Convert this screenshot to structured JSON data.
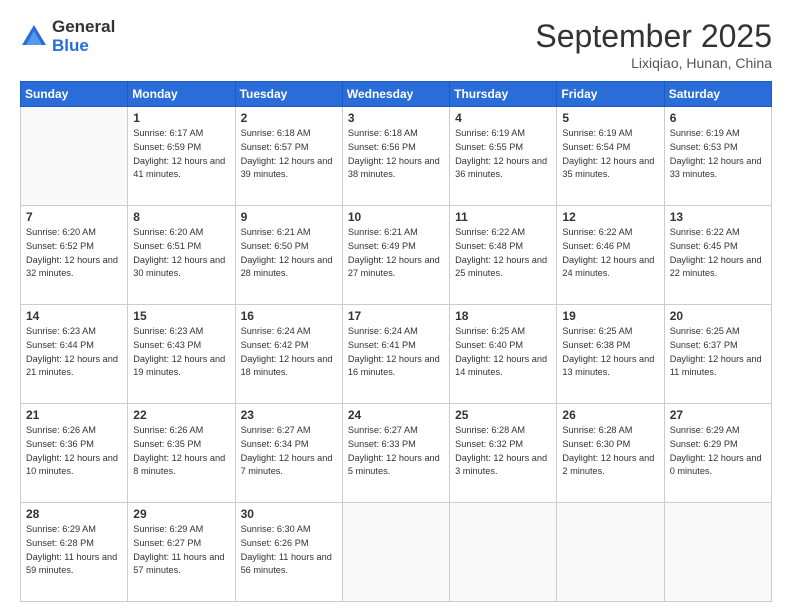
{
  "header": {
    "logo_general": "General",
    "logo_blue": "Blue",
    "month_title": "September 2025",
    "location": "Lixiqiao, Hunan, China"
  },
  "weekdays": [
    "Sunday",
    "Monday",
    "Tuesday",
    "Wednesday",
    "Thursday",
    "Friday",
    "Saturday"
  ],
  "weeks": [
    [
      {
        "day": "",
        "sunrise": "",
        "sunset": "",
        "daylight": ""
      },
      {
        "day": "1",
        "sunrise": "Sunrise: 6:17 AM",
        "sunset": "Sunset: 6:59 PM",
        "daylight": "Daylight: 12 hours and 41 minutes."
      },
      {
        "day": "2",
        "sunrise": "Sunrise: 6:18 AM",
        "sunset": "Sunset: 6:57 PM",
        "daylight": "Daylight: 12 hours and 39 minutes."
      },
      {
        "day": "3",
        "sunrise": "Sunrise: 6:18 AM",
        "sunset": "Sunset: 6:56 PM",
        "daylight": "Daylight: 12 hours and 38 minutes."
      },
      {
        "day": "4",
        "sunrise": "Sunrise: 6:19 AM",
        "sunset": "Sunset: 6:55 PM",
        "daylight": "Daylight: 12 hours and 36 minutes."
      },
      {
        "day": "5",
        "sunrise": "Sunrise: 6:19 AM",
        "sunset": "Sunset: 6:54 PM",
        "daylight": "Daylight: 12 hours and 35 minutes."
      },
      {
        "day": "6",
        "sunrise": "Sunrise: 6:19 AM",
        "sunset": "Sunset: 6:53 PM",
        "daylight": "Daylight: 12 hours and 33 minutes."
      }
    ],
    [
      {
        "day": "7",
        "sunrise": "Sunrise: 6:20 AM",
        "sunset": "Sunset: 6:52 PM",
        "daylight": "Daylight: 12 hours and 32 minutes."
      },
      {
        "day": "8",
        "sunrise": "Sunrise: 6:20 AM",
        "sunset": "Sunset: 6:51 PM",
        "daylight": "Daylight: 12 hours and 30 minutes."
      },
      {
        "day": "9",
        "sunrise": "Sunrise: 6:21 AM",
        "sunset": "Sunset: 6:50 PM",
        "daylight": "Daylight: 12 hours and 28 minutes."
      },
      {
        "day": "10",
        "sunrise": "Sunrise: 6:21 AM",
        "sunset": "Sunset: 6:49 PM",
        "daylight": "Daylight: 12 hours and 27 minutes."
      },
      {
        "day": "11",
        "sunrise": "Sunrise: 6:22 AM",
        "sunset": "Sunset: 6:48 PM",
        "daylight": "Daylight: 12 hours and 25 minutes."
      },
      {
        "day": "12",
        "sunrise": "Sunrise: 6:22 AM",
        "sunset": "Sunset: 6:46 PM",
        "daylight": "Daylight: 12 hours and 24 minutes."
      },
      {
        "day": "13",
        "sunrise": "Sunrise: 6:22 AM",
        "sunset": "Sunset: 6:45 PM",
        "daylight": "Daylight: 12 hours and 22 minutes."
      }
    ],
    [
      {
        "day": "14",
        "sunrise": "Sunrise: 6:23 AM",
        "sunset": "Sunset: 6:44 PM",
        "daylight": "Daylight: 12 hours and 21 minutes."
      },
      {
        "day": "15",
        "sunrise": "Sunrise: 6:23 AM",
        "sunset": "Sunset: 6:43 PM",
        "daylight": "Daylight: 12 hours and 19 minutes."
      },
      {
        "day": "16",
        "sunrise": "Sunrise: 6:24 AM",
        "sunset": "Sunset: 6:42 PM",
        "daylight": "Daylight: 12 hours and 18 minutes."
      },
      {
        "day": "17",
        "sunrise": "Sunrise: 6:24 AM",
        "sunset": "Sunset: 6:41 PM",
        "daylight": "Daylight: 12 hours and 16 minutes."
      },
      {
        "day": "18",
        "sunrise": "Sunrise: 6:25 AM",
        "sunset": "Sunset: 6:40 PM",
        "daylight": "Daylight: 12 hours and 14 minutes."
      },
      {
        "day": "19",
        "sunrise": "Sunrise: 6:25 AM",
        "sunset": "Sunset: 6:38 PM",
        "daylight": "Daylight: 12 hours and 13 minutes."
      },
      {
        "day": "20",
        "sunrise": "Sunrise: 6:25 AM",
        "sunset": "Sunset: 6:37 PM",
        "daylight": "Daylight: 12 hours and 11 minutes."
      }
    ],
    [
      {
        "day": "21",
        "sunrise": "Sunrise: 6:26 AM",
        "sunset": "Sunset: 6:36 PM",
        "daylight": "Daylight: 12 hours and 10 minutes."
      },
      {
        "day": "22",
        "sunrise": "Sunrise: 6:26 AM",
        "sunset": "Sunset: 6:35 PM",
        "daylight": "Daylight: 12 hours and 8 minutes."
      },
      {
        "day": "23",
        "sunrise": "Sunrise: 6:27 AM",
        "sunset": "Sunset: 6:34 PM",
        "daylight": "Daylight: 12 hours and 7 minutes."
      },
      {
        "day": "24",
        "sunrise": "Sunrise: 6:27 AM",
        "sunset": "Sunset: 6:33 PM",
        "daylight": "Daylight: 12 hours and 5 minutes."
      },
      {
        "day": "25",
        "sunrise": "Sunrise: 6:28 AM",
        "sunset": "Sunset: 6:32 PM",
        "daylight": "Daylight: 12 hours and 3 minutes."
      },
      {
        "day": "26",
        "sunrise": "Sunrise: 6:28 AM",
        "sunset": "Sunset: 6:30 PM",
        "daylight": "Daylight: 12 hours and 2 minutes."
      },
      {
        "day": "27",
        "sunrise": "Sunrise: 6:29 AM",
        "sunset": "Sunset: 6:29 PM",
        "daylight": "Daylight: 12 hours and 0 minutes."
      }
    ],
    [
      {
        "day": "28",
        "sunrise": "Sunrise: 6:29 AM",
        "sunset": "Sunset: 6:28 PM",
        "daylight": "Daylight: 11 hours and 59 minutes."
      },
      {
        "day": "29",
        "sunrise": "Sunrise: 6:29 AM",
        "sunset": "Sunset: 6:27 PM",
        "daylight": "Daylight: 11 hours and 57 minutes."
      },
      {
        "day": "30",
        "sunrise": "Sunrise: 6:30 AM",
        "sunset": "Sunset: 6:26 PM",
        "daylight": "Daylight: 11 hours and 56 minutes."
      },
      {
        "day": "",
        "sunrise": "",
        "sunset": "",
        "daylight": ""
      },
      {
        "day": "",
        "sunrise": "",
        "sunset": "",
        "daylight": ""
      },
      {
        "day": "",
        "sunrise": "",
        "sunset": "",
        "daylight": ""
      },
      {
        "day": "",
        "sunrise": "",
        "sunset": "",
        "daylight": ""
      }
    ]
  ]
}
